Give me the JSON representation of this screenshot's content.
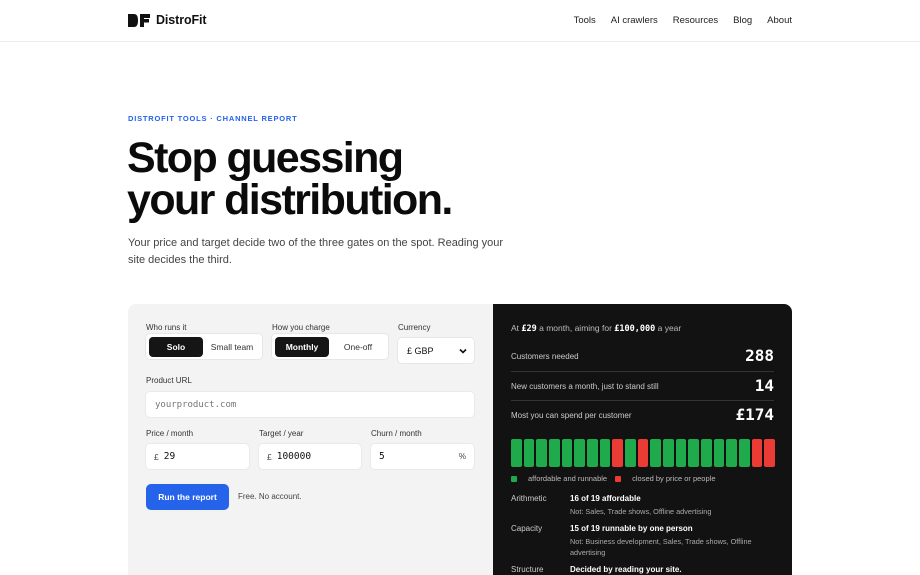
{
  "nav": {
    "brand": "DistroFit",
    "links": [
      "Tools",
      "AI crawlers",
      "Resources",
      "Blog",
      "About"
    ]
  },
  "hero": {
    "eyebrow": "DISTROFIT TOOLS · CHANNEL REPORT",
    "headline_line1": "Stop guessing",
    "headline_line2": "your distribution.",
    "subtitle": "Your price and target decide two of the three gates on the spot. Reading your site decides the third."
  },
  "form": {
    "who_label": "Who runs it",
    "who_options": [
      "Solo",
      "Small team"
    ],
    "who_selected": "Solo",
    "charge_label": "How you charge",
    "charge_options": [
      "Monthly",
      "One-off"
    ],
    "charge_selected": "Monthly",
    "currency_label": "Currency",
    "currency_value": "£ GBP",
    "url_label": "Product URL",
    "url_placeholder": "yourproduct.com",
    "price_label": "Price / month",
    "price_prefix": "£",
    "price_value": "29",
    "target_label": "Target / year",
    "target_prefix": "£",
    "target_value": "100000",
    "churn_label": "Churn / month",
    "churn_value": "5",
    "churn_suffix": "%",
    "run_button": "Run the report",
    "run_note": "Free. No account."
  },
  "report": {
    "head_pre": "At",
    "head_price": "£29",
    "head_mid": "a month, aiming for",
    "head_target": "£100,000",
    "head_post": "a year",
    "metrics": [
      {
        "label": "Customers needed",
        "value": "288"
      },
      {
        "label": "New customers a month, just to stand still",
        "value": "14"
      },
      {
        "label": "Most you can spend per customer",
        "value": "£174"
      }
    ],
    "channel_status": [
      "ok",
      "ok",
      "ok",
      "ok",
      "ok",
      "ok",
      "ok",
      "ok",
      "closed",
      "ok",
      "closed",
      "ok",
      "ok",
      "ok",
      "ok",
      "ok",
      "ok",
      "ok",
      "ok",
      "closed",
      "closed"
    ],
    "colors": {
      "ok": "#1faa4b",
      "closed": "#ea3b35",
      "accent": "#2563eb"
    },
    "legend_ok": "affordable and runnable",
    "legend_closed": "closed by price or people",
    "rows": [
      {
        "key": "Arithmetic",
        "value": "16 of 19 affordable",
        "detail": "Not: Sales, Trade shows, Offline advertising"
      },
      {
        "key": "Capacity",
        "value": "15 of 19 runnable by one person",
        "detail": "Not: Business development, Sales, Trade shows, Offline advertising"
      },
      {
        "key": "Structure",
        "value": "Decided by reading your site.",
        "detail": ""
      }
    ]
  }
}
